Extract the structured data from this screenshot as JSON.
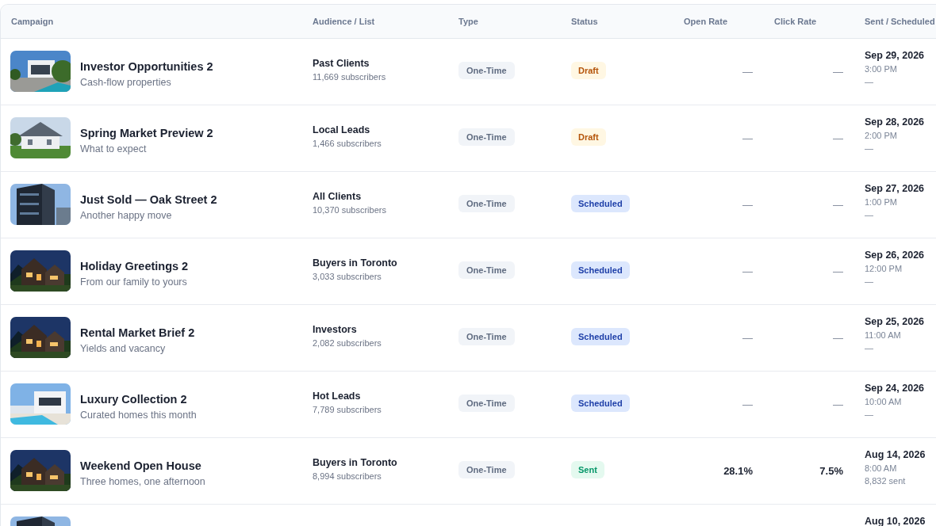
{
  "table": {
    "columns": [
      "Campaign",
      "Audience / List",
      "Type",
      "Status",
      "Open Rate",
      "Click Rate",
      "Sent / Scheduled"
    ],
    "rows": [
      {
        "name": "Investor Opportunities 2",
        "subtitle": "Cash-flow properties",
        "audience": "Past Clients",
        "subscribers": "11,669 subscribers",
        "type": "One-Time",
        "status": {
          "label": "Draft",
          "kind": "draft"
        },
        "open_rate": "—",
        "click_rate": "—",
        "date": "Sep 29, 2026",
        "time": "3:00 PM",
        "note": "—"
      },
      {
        "name": "Spring Market Preview 2",
        "subtitle": "What to expect",
        "audience": "Local Leads",
        "subscribers": "1,466 subscribers",
        "type": "One-Time",
        "status": {
          "label": "Draft",
          "kind": "draft"
        },
        "open_rate": "—",
        "click_rate": "—",
        "date": "Sep 28, 2026",
        "time": "2:00 PM",
        "note": "—"
      },
      {
        "name": "Just Sold — Oak Street 2",
        "subtitle": "Another happy move",
        "audience": "All Clients",
        "subscribers": "10,370 subscribers",
        "type": "One-Time",
        "status": {
          "label": "Scheduled",
          "kind": "scheduled"
        },
        "open_rate": "—",
        "click_rate": "—",
        "date": "Sep 27, 2026",
        "time": "1:00 PM",
        "note": "—"
      },
      {
        "name": "Holiday Greetings 2",
        "subtitle": "From our family to yours",
        "audience": "Buyers in Toronto",
        "subscribers": "3,033 subscribers",
        "type": "One-Time",
        "status": {
          "label": "Scheduled",
          "kind": "scheduled"
        },
        "open_rate": "—",
        "click_rate": "—",
        "date": "Sep 26, 2026",
        "time": "12:00 PM",
        "note": "—"
      },
      {
        "name": "Rental Market Brief 2",
        "subtitle": "Yields and vacancy",
        "audience": "Investors",
        "subscribers": "2,082 subscribers",
        "type": "One-Time",
        "status": {
          "label": "Scheduled",
          "kind": "scheduled"
        },
        "open_rate": "—",
        "click_rate": "—",
        "date": "Sep 25, 2026",
        "time": "11:00 AM",
        "note": "—"
      },
      {
        "name": "Luxury Collection 2",
        "subtitle": "Curated homes this month",
        "audience": "Hot Leads",
        "subscribers": "7,789 subscribers",
        "type": "One-Time",
        "status": {
          "label": "Scheduled",
          "kind": "scheduled"
        },
        "open_rate": "—",
        "click_rate": "—",
        "date": "Sep 24, 2026",
        "time": "10:00 AM",
        "note": "—"
      },
      {
        "name": "Weekend Open House",
        "subtitle": "Three homes, one afternoon",
        "audience": "Buyers in Toronto",
        "subscribers": "8,994 subscribers",
        "type": "One-Time",
        "status": {
          "label": "Sent",
          "kind": "sent"
        },
        "open_rate": "28.1%",
        "click_rate": "7.5%",
        "date": "Aug 14, 2026",
        "time": "8:00 AM",
        "note": "8,832 sent"
      },
      {
        "date": "Aug 10, 2026"
      }
    ]
  }
}
